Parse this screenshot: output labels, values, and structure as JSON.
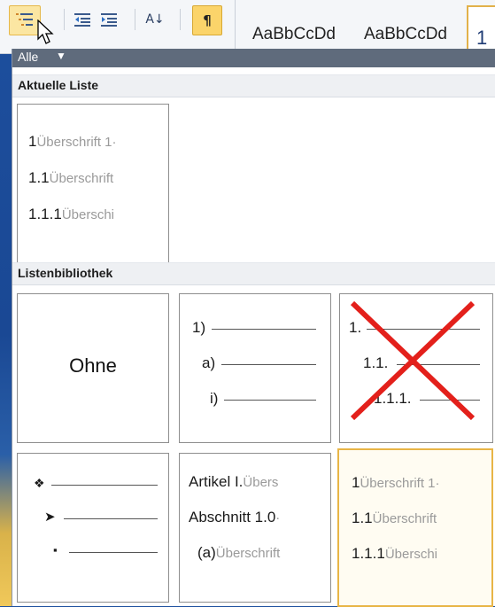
{
  "ribbon": {
    "style_samples": [
      "AaBbCcDd",
      "AaBbCcDd"
    ],
    "style_box_label": "1",
    "pilcrow": "¶",
    "sort": "A↓",
    "indent_dec": "⇤",
    "indent_inc": "⇥"
  },
  "panel": {
    "filter_label": "Alle",
    "filter_arrow": "▼",
    "current_header": "Aktuelle Liste",
    "library_header": "Listenbibliothek",
    "current_list": {
      "rows": [
        {
          "num": "1",
          "text": "Überschrift 1·"
        },
        {
          "num": "1.1",
          "text": "Überschrift"
        },
        {
          "num": "1.1.1",
          "text": "Überschi"
        }
      ]
    },
    "library": {
      "none_label": "Ohne",
      "paren_list": [
        "1)",
        "a)",
        "i)"
      ],
      "crossed_list": [
        "1.",
        "1.1.",
        "1.1.1."
      ],
      "bullet_list": [
        "❖",
        "➤",
        "▪"
      ],
      "article_list": [
        {
          "num": "Artikel I.",
          "text": "Übers"
        },
        {
          "num": "Abschnitt 1.0",
          "text": "·"
        },
        {
          "num": "(a)",
          "text": "Überschrift"
        }
      ],
      "heading_list": [
        {
          "num": "1",
          "text": "Überschrift 1·"
        },
        {
          "num": "1.1",
          "text": "Überschrift"
        },
        {
          "num": "1.1.1",
          "text": "Überschi"
        }
      ]
    }
  },
  "colors": {
    "selection_border": "#e8b546",
    "cross": "#e3201b",
    "filter_bar": "#5f6b7c"
  }
}
